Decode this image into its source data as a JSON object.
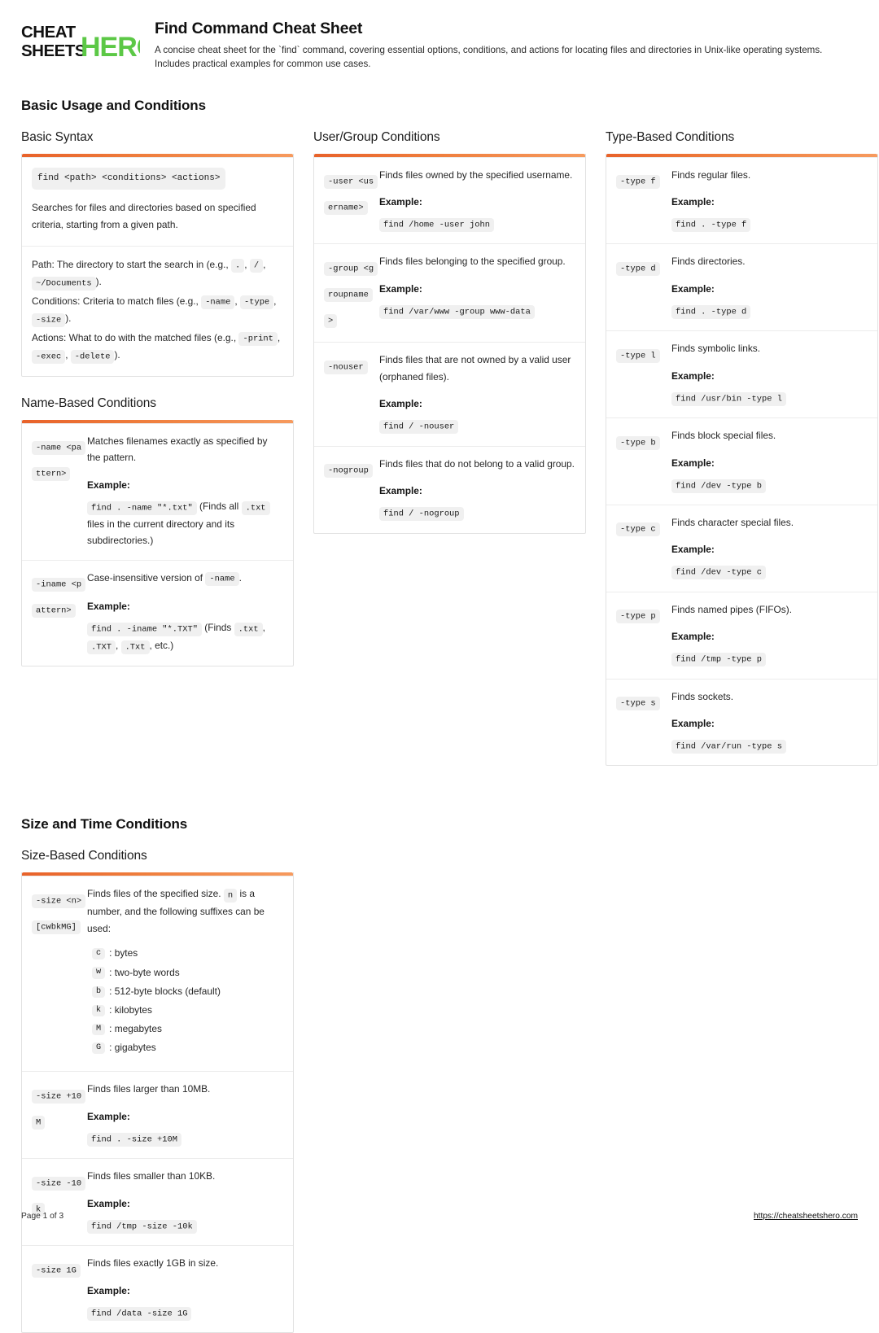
{
  "brand": {
    "line1": "CHEAT",
    "line2": "SHEETS",
    "accent_word": "HERO",
    "accent_color": "#5cc846",
    "text_color": "#111111"
  },
  "header": {
    "title": "Find Command Cheat Sheet",
    "description": "A concise cheat sheet for the `find` command, covering essential options, conditions, and actions for locating files and directories in Unix-like operating systems. Includes practical examples for common use cases."
  },
  "theme": {
    "accent_start": "#e8622a",
    "accent_end": "#f69a5e",
    "chip_bg": "#f0f0f0",
    "card_border": "#e2e2e2"
  },
  "sections": [
    {
      "title": "Basic Usage and Conditions",
      "groups": {
        "basic_syntax": {
          "title": "Basic Syntax",
          "syntax": "find <path> <conditions> <actions>",
          "lede": "Searches for files and directories based on specified criteria, starting from a given path.",
          "path_prefix": "Path: The directory to start the search in (e.g.,",
          "path_chip1": ".",
          "path_chip2": "/",
          "path_chip3": "~/Documents",
          "path_suffix": ").",
          "cond_prefix": "Conditions: Criteria to match files (e.g.,",
          "cond_chip1": "-name",
          "cond_chip2": "-type",
          "cond_chip3": "-size",
          "cond_suffix": ").",
          "act_prefix": "Actions: What to do with the matched files (e.g.,",
          "act_chip1": "-print",
          "act_chip2": "-exec",
          "act_chip3": "-delete",
          "act_suffix": ")."
        },
        "name_based": {
          "title": "Name-Based Conditions",
          "example_label": "Example:",
          "rows": [
            {
              "term": "-name <pattern>",
              "desc": "Matches filenames exactly as specified by the pattern.",
              "example_cmd": "find . -name \"*.txt\"",
              "example_note_1": "(Finds all",
              "example_chip_1": ".txt",
              "example_note_2": "files in the current directory and its subdirectories.)"
            },
            {
              "term": "-iname <pattern>",
              "desc_prefix": "Case-insensitive version of",
              "desc_chip": "-name",
              "desc_suffix": ".",
              "example_cmd": "find . -iname \"*.TXT\"",
              "example_note_1": "(Finds",
              "example_chip_1": ".txt",
              "example_chip_2": ".TXT",
              "example_chip_3": ".Txt",
              "example_note_2": ", etc.)"
            }
          ]
        },
        "user_group": {
          "title": "User/Group Conditions",
          "example_label": "Example:",
          "rows": [
            {
              "term": "-user <username>",
              "desc": "Finds files owned by the specified username.",
              "example_cmd": "find /home -user john"
            },
            {
              "term": "-group <groupname>",
              "desc": "Finds files belonging to the specified group.",
              "example_cmd": "find /var/www -group www-data"
            },
            {
              "term": "-nouser",
              "desc": "Finds files that are not owned by a valid user (orphaned files).",
              "example_cmd": "find / -nouser"
            },
            {
              "term": "-nogroup",
              "desc": "Finds files that do not belong to a valid group.",
              "example_cmd": "find / -nogroup"
            }
          ]
        },
        "type_based": {
          "title": "Type-Based Conditions",
          "example_label": "Example:",
          "rows": [
            {
              "term": "-type f",
              "desc": "Finds regular files.",
              "example_cmd": "find . -type f"
            },
            {
              "term": "-type d",
              "desc": "Finds directories.",
              "example_cmd": "find . -type d"
            },
            {
              "term": "-type l",
              "desc": "Finds symbolic links.",
              "example_cmd": "find /usr/bin -type l"
            },
            {
              "term": "-type b",
              "desc": "Finds block special files.",
              "example_cmd": "find /dev -type b"
            },
            {
              "term": "-type c",
              "desc": "Finds character special files.",
              "example_cmd": "find /dev -type c"
            },
            {
              "term": "-type p",
              "desc": "Finds named pipes (FIFOs).",
              "example_cmd": "find /tmp -type p"
            },
            {
              "term": "-type s",
              "desc": "Finds sockets.",
              "example_cmd": "find /var/run -type s"
            }
          ]
        }
      }
    },
    {
      "title": "Size and Time Conditions",
      "groups": {
        "size_based": {
          "title": "Size-Based Conditions",
          "example_label": "Example:",
          "intro_row": {
            "term": "-size <n>[cwbkMG]",
            "desc_prefix": "Finds files of the specified size.",
            "desc_chip": "n",
            "desc_suffix": "is a number, and the following suffixes can be used:",
            "suffixes": [
              {
                "chip": "c",
                "label": ": bytes"
              },
              {
                "chip": "w",
                "label": ": two-byte words"
              },
              {
                "chip": "b",
                "label": ": 512-byte blocks (default)"
              },
              {
                "chip": "k",
                "label": ": kilobytes"
              },
              {
                "chip": "M",
                "label": ": megabytes"
              },
              {
                "chip": "G",
                "label": ": gigabytes"
              }
            ]
          },
          "rows": [
            {
              "term": "-size +10M",
              "desc": "Finds files larger than 10MB.",
              "example_cmd": "find . -size +10M"
            },
            {
              "term": "-size -10k",
              "desc": "Finds files smaller than 10KB.",
              "example_cmd": "find /tmp -size -10k"
            },
            {
              "term": "-size 1G",
              "desc": "Finds files exactly 1GB in size.",
              "example_cmd": "find /data -size 1G"
            }
          ]
        }
      }
    }
  ],
  "footer": {
    "page_label": "Page 1 of 3",
    "url": "https://cheatsheetshero.com"
  }
}
